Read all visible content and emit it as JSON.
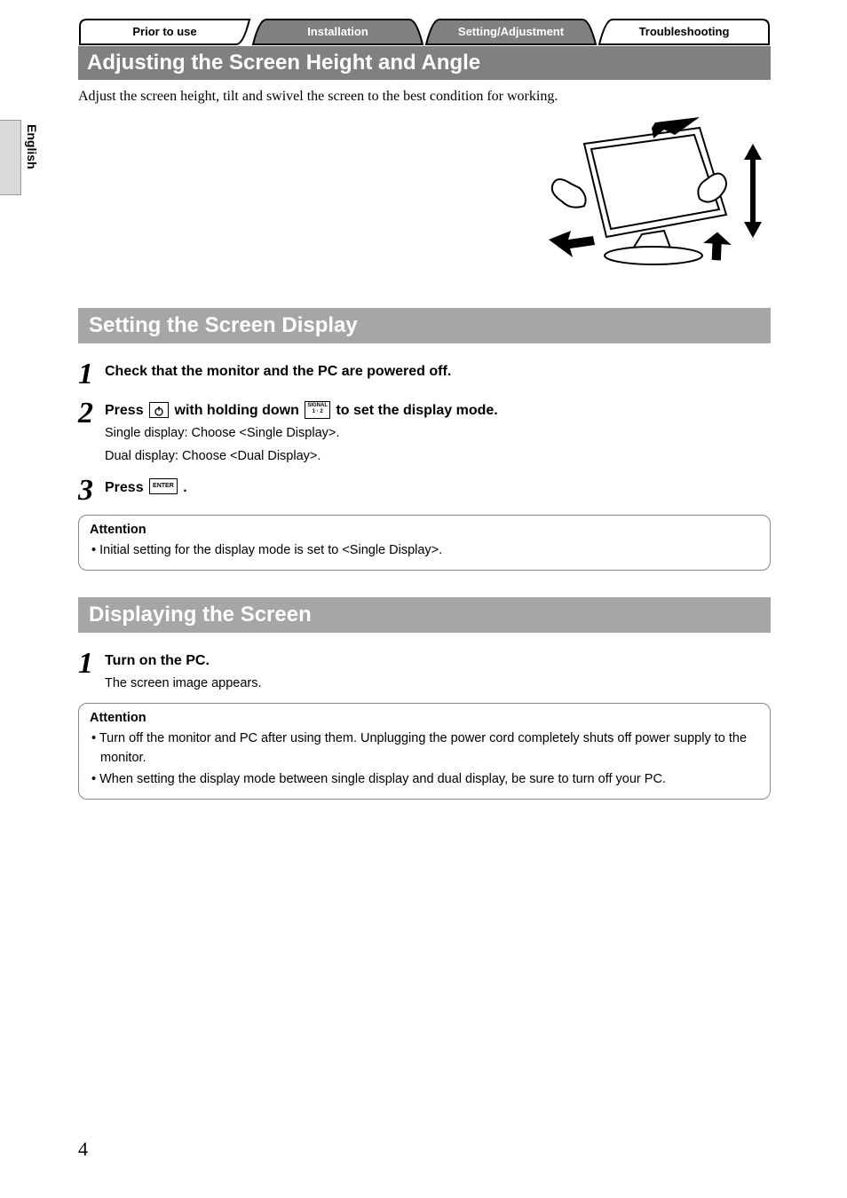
{
  "side_tab": "English",
  "tabs": {
    "t1": "Prior to use",
    "t2": "Installation",
    "t3": "Setting/Adjustment",
    "t4": "Troubleshooting"
  },
  "section1": {
    "title": "Adjusting the Screen Height and Angle",
    "intro": "Adjust the screen height, tilt and swivel the screen to the best condition for working."
  },
  "section2": {
    "title": "Setting the Screen Display",
    "steps": {
      "s1": {
        "num": "1",
        "title": "Check that the monitor and the PC are powered off."
      },
      "s2": {
        "num": "2",
        "title_a": "Press ",
        "title_b": " with holding down ",
        "title_c": " to set the display mode.",
        "line1": "Single display: Choose <Single Display>.",
        "line2": "Dual display: Choose <Dual Display>."
      },
      "s3": {
        "num": "3",
        "title_a": "Press ",
        "title_b": " ."
      }
    },
    "attention": {
      "title": "Attention",
      "item1": "Initial setting for the display mode is set to <Single Display>."
    }
  },
  "section3": {
    "title": "Displaying the Screen",
    "steps": {
      "s1": {
        "num": "1",
        "title": "Turn on the PC.",
        "line1": "The screen image appears."
      }
    },
    "attention": {
      "title": "Attention",
      "item1": "Turn off the monitor and PC after using them. Unplugging the power cord completely shuts off power supply to the monitor.",
      "item2": "When setting the display mode between single display and dual display, be sure to turn off your PC."
    }
  },
  "icons": {
    "signal_top": "SIGNAL",
    "signal_bot": "1 · 2",
    "enter": "ENTER"
  },
  "page_number": "4"
}
